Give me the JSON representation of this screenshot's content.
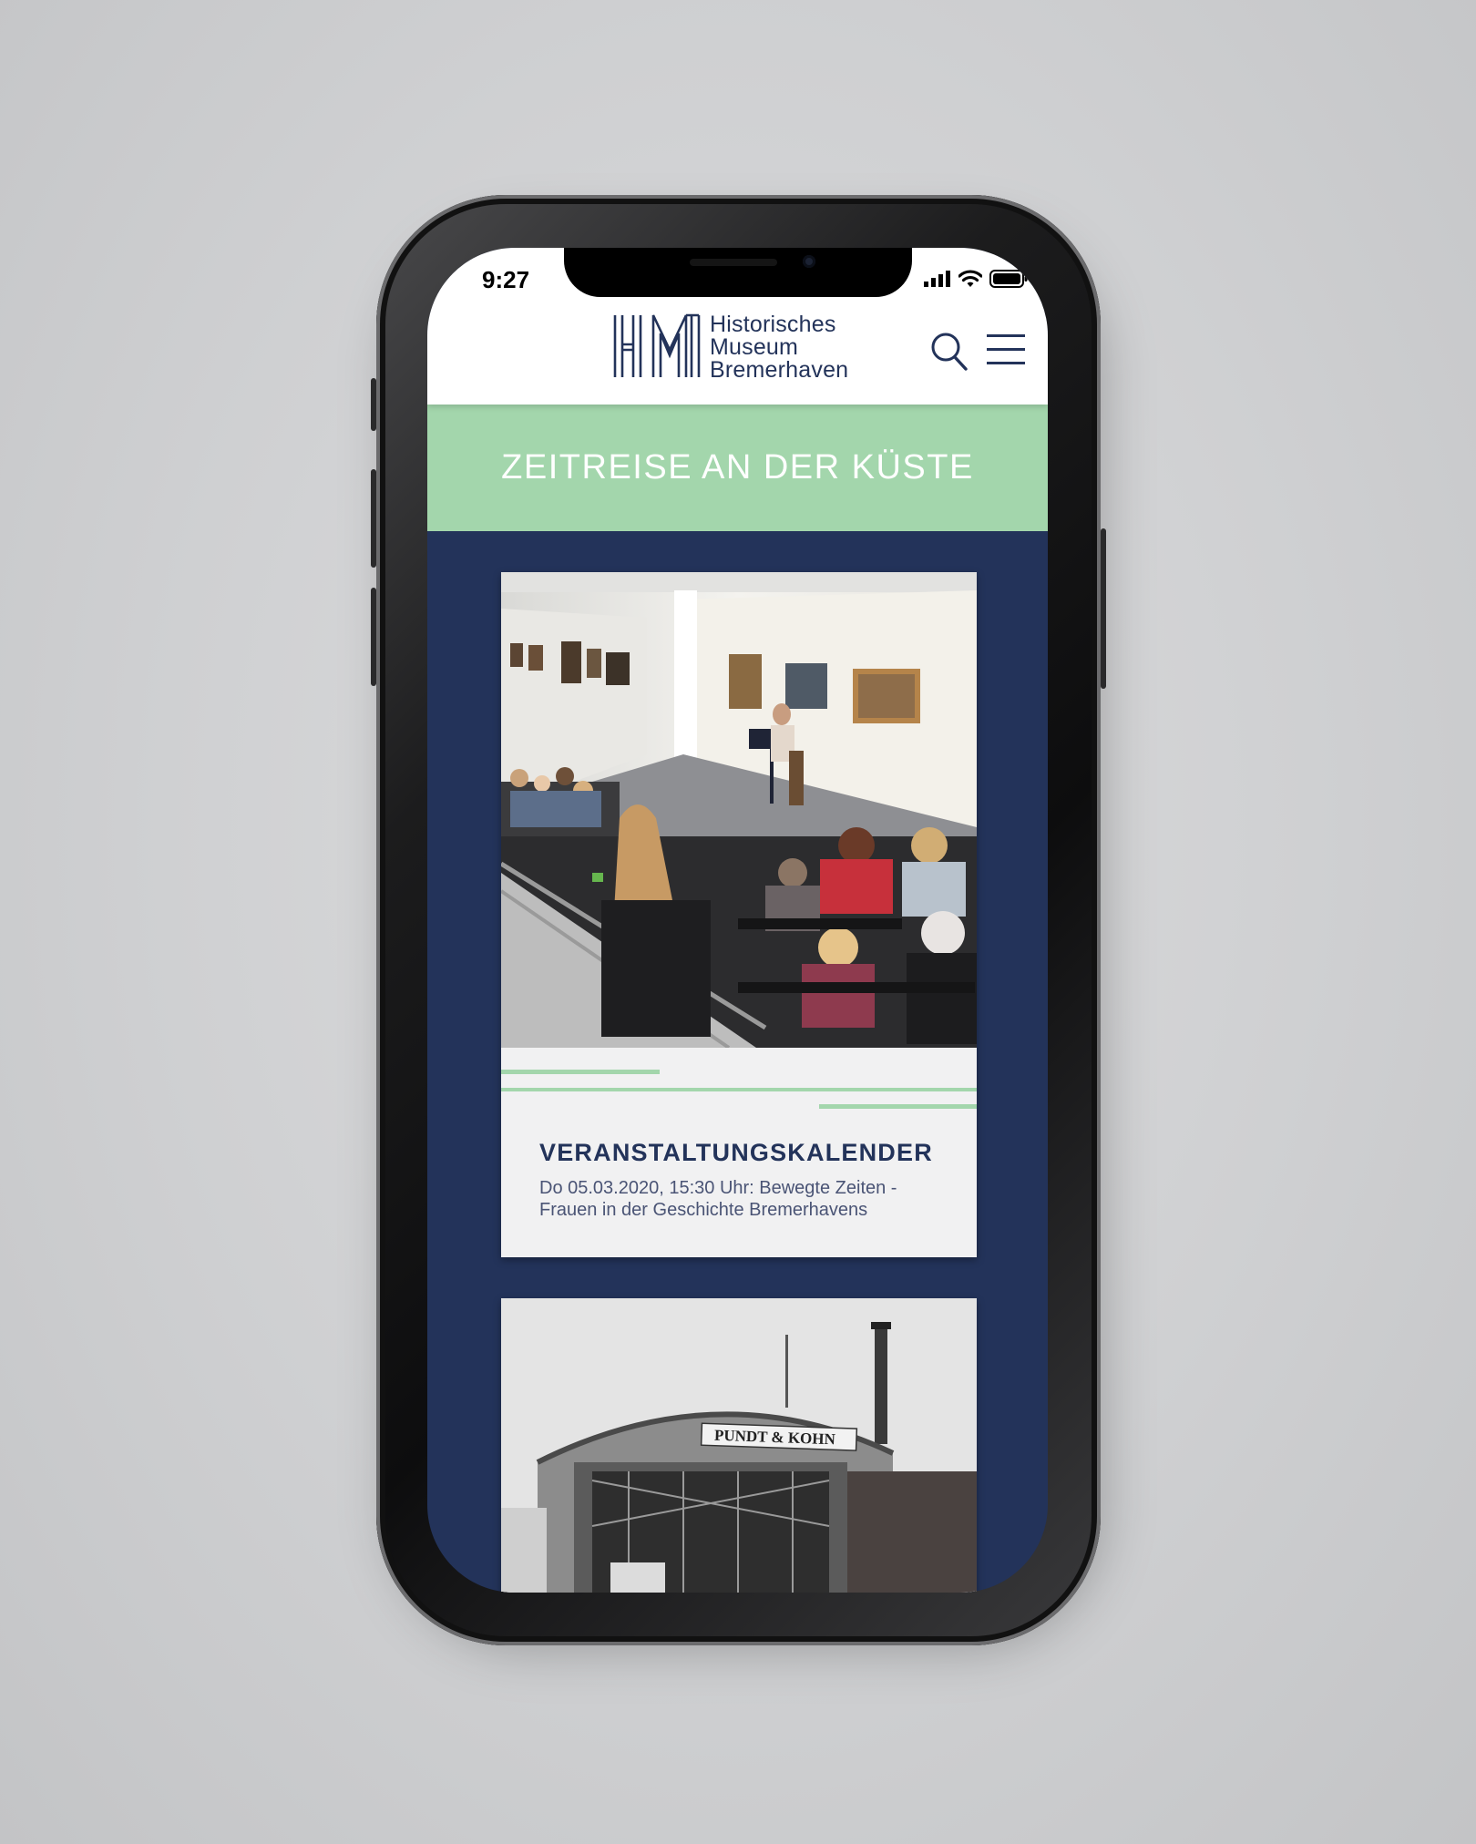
{
  "status_bar": {
    "time": "9:27"
  },
  "header": {
    "logo_lines": [
      "Historisches",
      "Museum",
      "Bremerhaven"
    ],
    "search_icon": "search-icon",
    "menu_icon": "hamburger-menu-icon"
  },
  "banner": {
    "title": "ZEITREISE AN DER KÜSTE"
  },
  "cards": [
    {
      "title": "VERANSTALTUNGSKALENDER",
      "description": "Do 05.03.2020, 15:30 Uhr: Bewegte Zeiten - Frauen in der Geschichte Bremerhavens"
    },
    {
      "image_sign": "PUNDT & KOHN"
    }
  ],
  "colors": {
    "navy": "#23335a",
    "mint": "#a3d6ac",
    "card_bg": "#f1f1f2"
  }
}
